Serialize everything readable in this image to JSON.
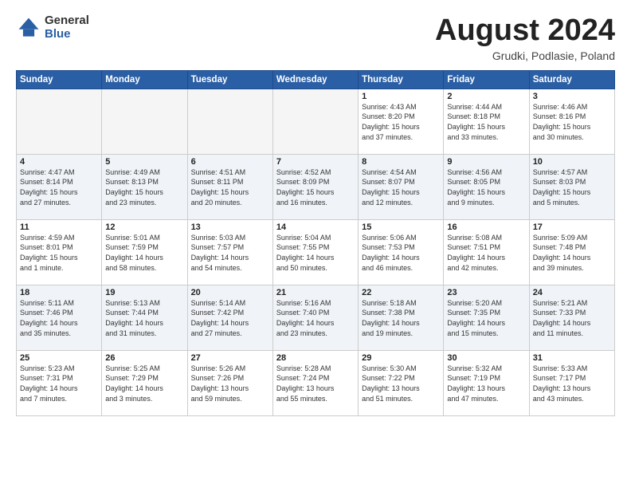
{
  "header": {
    "logo_general": "General",
    "logo_blue": "Blue",
    "month": "August 2024",
    "location": "Grudki, Podlasie, Poland"
  },
  "weekdays": [
    "Sunday",
    "Monday",
    "Tuesday",
    "Wednesday",
    "Thursday",
    "Friday",
    "Saturday"
  ],
  "weeks": [
    [
      {
        "day": "",
        "info": ""
      },
      {
        "day": "",
        "info": ""
      },
      {
        "day": "",
        "info": ""
      },
      {
        "day": "",
        "info": ""
      },
      {
        "day": "1",
        "info": "Sunrise: 4:43 AM\nSunset: 8:20 PM\nDaylight: 15 hours\nand 37 minutes."
      },
      {
        "day": "2",
        "info": "Sunrise: 4:44 AM\nSunset: 8:18 PM\nDaylight: 15 hours\nand 33 minutes."
      },
      {
        "day": "3",
        "info": "Sunrise: 4:46 AM\nSunset: 8:16 PM\nDaylight: 15 hours\nand 30 minutes."
      }
    ],
    [
      {
        "day": "4",
        "info": "Sunrise: 4:47 AM\nSunset: 8:14 PM\nDaylight: 15 hours\nand 27 minutes."
      },
      {
        "day": "5",
        "info": "Sunrise: 4:49 AM\nSunset: 8:13 PM\nDaylight: 15 hours\nand 23 minutes."
      },
      {
        "day": "6",
        "info": "Sunrise: 4:51 AM\nSunset: 8:11 PM\nDaylight: 15 hours\nand 20 minutes."
      },
      {
        "day": "7",
        "info": "Sunrise: 4:52 AM\nSunset: 8:09 PM\nDaylight: 15 hours\nand 16 minutes."
      },
      {
        "day": "8",
        "info": "Sunrise: 4:54 AM\nSunset: 8:07 PM\nDaylight: 15 hours\nand 12 minutes."
      },
      {
        "day": "9",
        "info": "Sunrise: 4:56 AM\nSunset: 8:05 PM\nDaylight: 15 hours\nand 9 minutes."
      },
      {
        "day": "10",
        "info": "Sunrise: 4:57 AM\nSunset: 8:03 PM\nDaylight: 15 hours\nand 5 minutes."
      }
    ],
    [
      {
        "day": "11",
        "info": "Sunrise: 4:59 AM\nSunset: 8:01 PM\nDaylight: 15 hours\nand 1 minute."
      },
      {
        "day": "12",
        "info": "Sunrise: 5:01 AM\nSunset: 7:59 PM\nDaylight: 14 hours\nand 58 minutes."
      },
      {
        "day": "13",
        "info": "Sunrise: 5:03 AM\nSunset: 7:57 PM\nDaylight: 14 hours\nand 54 minutes."
      },
      {
        "day": "14",
        "info": "Sunrise: 5:04 AM\nSunset: 7:55 PM\nDaylight: 14 hours\nand 50 minutes."
      },
      {
        "day": "15",
        "info": "Sunrise: 5:06 AM\nSunset: 7:53 PM\nDaylight: 14 hours\nand 46 minutes."
      },
      {
        "day": "16",
        "info": "Sunrise: 5:08 AM\nSunset: 7:51 PM\nDaylight: 14 hours\nand 42 minutes."
      },
      {
        "day": "17",
        "info": "Sunrise: 5:09 AM\nSunset: 7:48 PM\nDaylight: 14 hours\nand 39 minutes."
      }
    ],
    [
      {
        "day": "18",
        "info": "Sunrise: 5:11 AM\nSunset: 7:46 PM\nDaylight: 14 hours\nand 35 minutes."
      },
      {
        "day": "19",
        "info": "Sunrise: 5:13 AM\nSunset: 7:44 PM\nDaylight: 14 hours\nand 31 minutes."
      },
      {
        "day": "20",
        "info": "Sunrise: 5:14 AM\nSunset: 7:42 PM\nDaylight: 14 hours\nand 27 minutes."
      },
      {
        "day": "21",
        "info": "Sunrise: 5:16 AM\nSunset: 7:40 PM\nDaylight: 14 hours\nand 23 minutes."
      },
      {
        "day": "22",
        "info": "Sunrise: 5:18 AM\nSunset: 7:38 PM\nDaylight: 14 hours\nand 19 minutes."
      },
      {
        "day": "23",
        "info": "Sunrise: 5:20 AM\nSunset: 7:35 PM\nDaylight: 14 hours\nand 15 minutes."
      },
      {
        "day": "24",
        "info": "Sunrise: 5:21 AM\nSunset: 7:33 PM\nDaylight: 14 hours\nand 11 minutes."
      }
    ],
    [
      {
        "day": "25",
        "info": "Sunrise: 5:23 AM\nSunset: 7:31 PM\nDaylight: 14 hours\nand 7 minutes."
      },
      {
        "day": "26",
        "info": "Sunrise: 5:25 AM\nSunset: 7:29 PM\nDaylight: 14 hours\nand 3 minutes."
      },
      {
        "day": "27",
        "info": "Sunrise: 5:26 AM\nSunset: 7:26 PM\nDaylight: 13 hours\nand 59 minutes."
      },
      {
        "day": "28",
        "info": "Sunrise: 5:28 AM\nSunset: 7:24 PM\nDaylight: 13 hours\nand 55 minutes."
      },
      {
        "day": "29",
        "info": "Sunrise: 5:30 AM\nSunset: 7:22 PM\nDaylight: 13 hours\nand 51 minutes."
      },
      {
        "day": "30",
        "info": "Sunrise: 5:32 AM\nSunset: 7:19 PM\nDaylight: 13 hours\nand 47 minutes."
      },
      {
        "day": "31",
        "info": "Sunrise: 5:33 AM\nSunset: 7:17 PM\nDaylight: 13 hours\nand 43 minutes."
      }
    ]
  ]
}
